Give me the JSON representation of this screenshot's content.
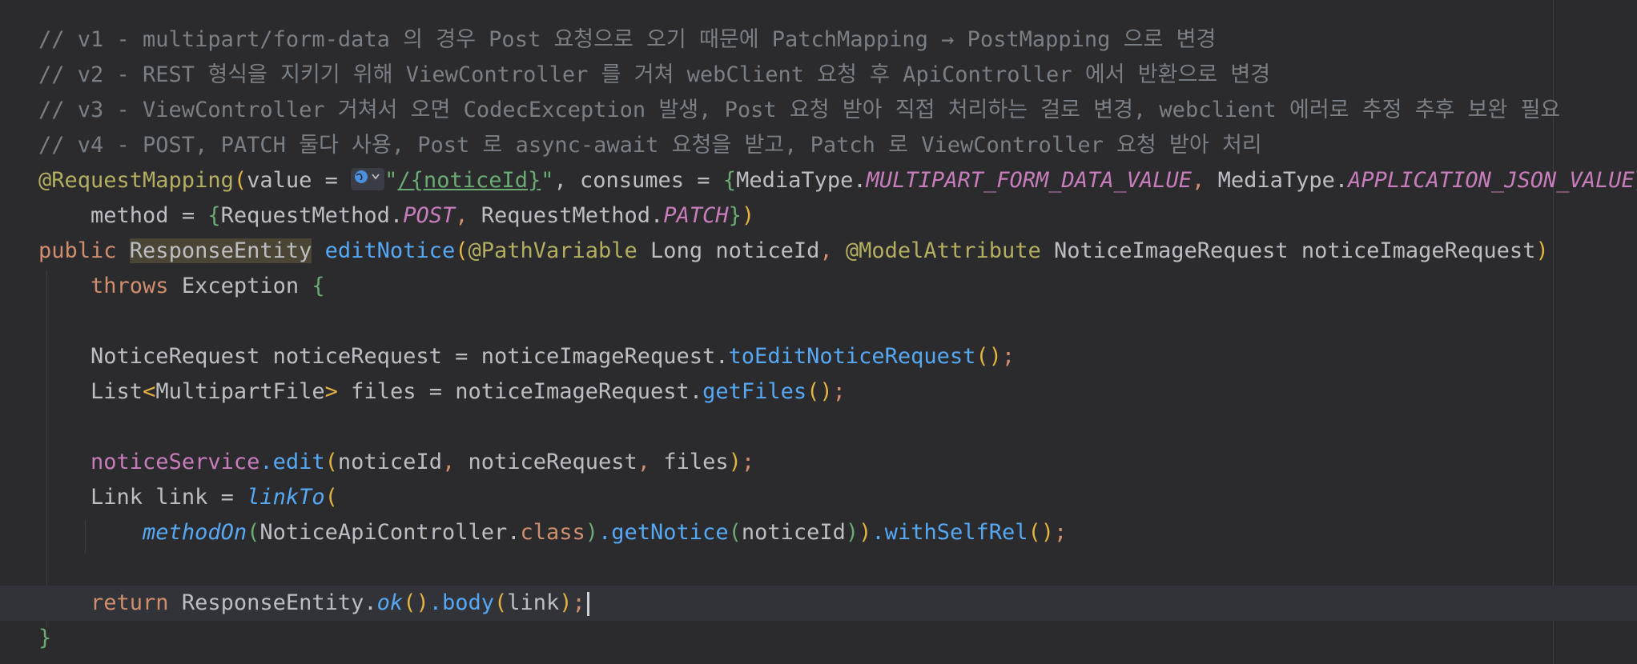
{
  "editor": {
    "comments": [
      "// v1 - multipart/form-data 의 경우 Post 요청으로 오기 때문에 PatchMapping → PostMapping 으로 변경",
      "// v2 - REST 형식을 지키기 위해 ViewController 를 거쳐 webClient 요청 후 ApiController 에서 반환으로 변경",
      "// v3 - ViewController 거쳐서 오면 CodecException 발생, Post 요청 받아 직접 처리하는 걸로 변경, webclient 에러로 추정 추후 보완 필요",
      "// v4 - POST, PATCH 둘다 사용, Post 로 async-await 요청을 받고, Patch 로 ViewController 요청 받아 처리"
    ],
    "tokens": {
      "request_mapping": "@RequestMapping",
      "value_eq": "value = ",
      "path": "/{noticeId}",
      "consumes": ", consumes = ",
      "media_type": "MediaType.",
      "multipart": "MULTIPART_FORM_DATA_VALUE",
      "app_json": "APPLICATION_JSON_VALUE",
      "method_eq": "method = ",
      "request_method": "RequestMethod.",
      "post": "POST",
      "patch": "PATCH",
      "public": "public ",
      "response_entity": "ResponseEntity",
      "edit_notice": "editNotice",
      "path_variable": "@PathVariable",
      "long_notice_id": " Long noticeId",
      "model_attribute": "@ModelAttribute",
      "notice_image_request_param": " NoticeImageRequest noticeImageRequest",
      "throws": "throws ",
      "exception": "Exception ",
      "line_notice_request": "NoticeRequest noticeRequest = noticeImageRequest.",
      "to_edit": "toEditNoticeRequest",
      "list": "List",
      "multipart_file": "MultipartFile",
      "files_eq": " files = noticeImageRequest.",
      "get_files": "getFiles",
      "notice_service": "noticeService",
      "edit": ".edit",
      "edit_args": "noticeId",
      "notice_request_arg": " noticeRequest",
      "files_arg": " files",
      "link_eq": "Link link = ",
      "link_to": "linkTo",
      "method_on": "methodOn",
      "controller": "NoticeApiController.",
      "class_kw": "class",
      "get_notice": ".getNotice",
      "notice_id": "noticeId",
      "with_self": ".withSelfRel",
      "return": "return ",
      "response_entity_dot": "ResponseEntity.",
      "ok": "ok",
      "body": ".body",
      "link_arg": "link"
    }
  }
}
